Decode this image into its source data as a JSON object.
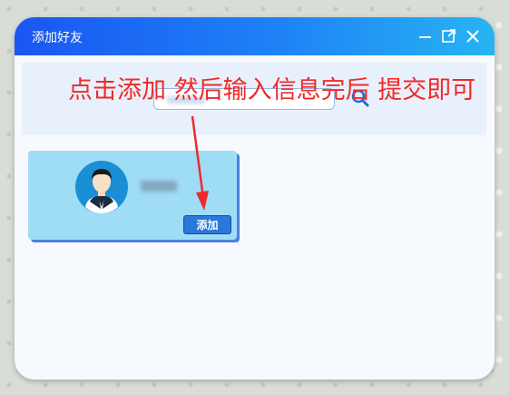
{
  "window": {
    "title": "添加好友"
  },
  "search": {
    "placeholder": ""
  },
  "annotation": {
    "text": "点击添加 然后输入信息完后 提交即可"
  },
  "result_card": {
    "add_label": "添加"
  },
  "colors": {
    "titlebar_start": "#1a56f2",
    "titlebar_end": "#27b4f2",
    "card_bg": "#9fdcf6",
    "annotation": "#ef2a2a",
    "add_button": "#2a78d8"
  },
  "icons": [
    "minimize-icon",
    "maximize-icon",
    "close-icon",
    "search-icon",
    "user-avatar-icon"
  ]
}
